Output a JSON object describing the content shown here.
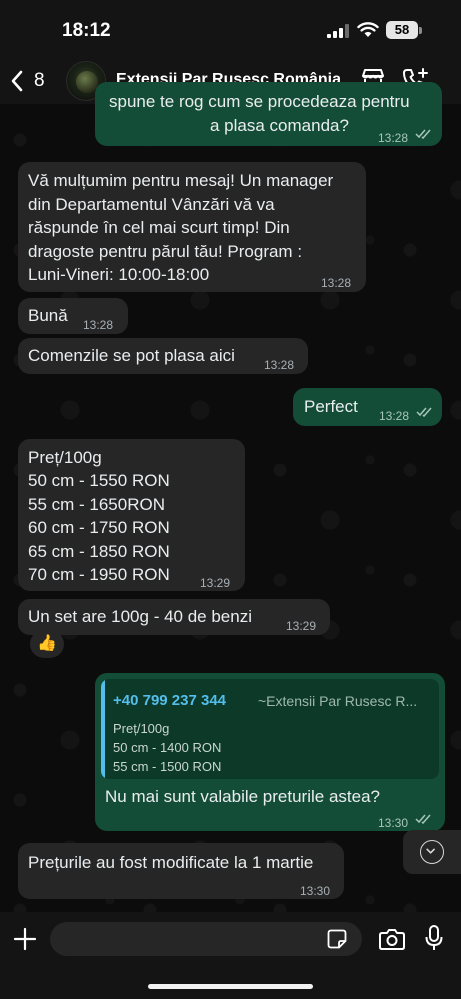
{
  "status_bar": {
    "time": "18:12",
    "battery": "58"
  },
  "header": {
    "back_count": "8",
    "title": "Extensii Par Rusesc România"
  },
  "messages": [
    {
      "dir": "out",
      "lines": [
        "spune te rog cum se procedeaza pentru",
        "a plasa comanda?"
      ],
      "time": "13:28",
      "read": true
    },
    {
      "dir": "in",
      "lines": [
        "Vă mulțumim pentru mesaj! Un manager",
        "din Departamentul Vânzări vă va",
        "răspunde în cel mai scurt timp! Din",
        "dragoste pentru părul tău! Program :",
        "Luni-Vineri: 10:00-18:00"
      ],
      "time": "13:28"
    },
    {
      "dir": "in",
      "lines": [
        "Bună"
      ],
      "time": "13:28"
    },
    {
      "dir": "in",
      "lines": [
        "Comenzile se pot plasa aici"
      ],
      "time": "13:28"
    },
    {
      "dir": "out",
      "lines": [
        "Perfect"
      ],
      "time": "13:28",
      "read": true
    },
    {
      "dir": "in",
      "lines": [
        "Preț/100g",
        "50 cm - 1550 RON",
        "55 cm - 1650RON",
        "60 cm - 1750 RON",
        "65 cm - 1850 RON",
        "70 cm - 1950 RON"
      ],
      "time": "13:29"
    },
    {
      "dir": "in",
      "lines": [
        "Un set are 100g - 40 de benzi"
      ],
      "time": "13:29",
      "reaction": "👍"
    },
    {
      "dir": "out",
      "quote": {
        "phone": "+40 799 237 344",
        "name": "~Extensii Par Rusesc R...",
        "lines": [
          "Preț/100g",
          "50 cm - 1400 RON",
          "55 cm - 1500 RON"
        ]
      },
      "lines": [
        "Nu mai sunt valabile preturile astea?"
      ],
      "time": "13:30",
      "read": true
    },
    {
      "dir": "in",
      "lines": [
        "Prețurile au fost modificate la 1 martie"
      ],
      "time": "13:30"
    }
  ],
  "composer": {
    "placeholder": ""
  },
  "colors": {
    "incoming": "#262626",
    "outgoing": "#144d37",
    "accent": "#53bdeb"
  },
  "icons": [
    "back-chevron-icon",
    "shop-icon",
    "call-add-icon",
    "plus-icon",
    "sticker-icon",
    "camera-icon",
    "mic-icon",
    "chevron-down-icon"
  ]
}
